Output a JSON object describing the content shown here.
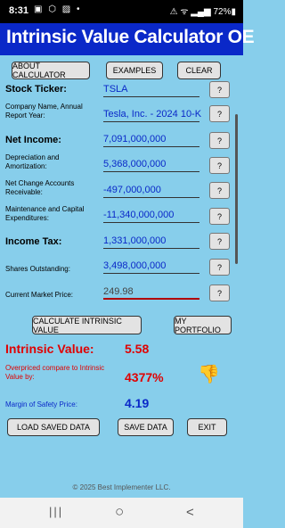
{
  "status": {
    "time": "8:31",
    "left_icons": "▣ ⬡ ▨ •",
    "right_icons": "⚠ ᯤ ▂▄▆ 72%▮"
  },
  "app": {
    "title": "Intrinsic Value Calculator OE"
  },
  "toolbar": {
    "about": "ABOUT CALCULATOR",
    "examples": "EXAMPLES",
    "clear": "CLEAR"
  },
  "fields": {
    "stock_ticker": {
      "label": "Stock Ticker:",
      "value": "TSLA"
    },
    "company_name": {
      "label": "Company Name,  Annual Report Year:",
      "value": "Tesla, Inc. - 2024 10-K"
    },
    "net_income": {
      "label": "Net Income:",
      "value": "7,091,000,000"
    },
    "depreciation": {
      "label": "Depreciation and Amortization:",
      "value": "5,368,000,000"
    },
    "net_change_ar": {
      "label": "Net Change Accounts Receivable:",
      "value": "-497,000,000"
    },
    "maintenance_capex": {
      "label": "Maintenance and Capital Expenditures:",
      "value": "-11,340,000,000"
    },
    "income_tax": {
      "label": "Income Tax:",
      "value": "1,331,000,000"
    },
    "shares_outstanding": {
      "label": "Shares Outstanding:",
      "value": "3,498,000,000"
    },
    "market_price": {
      "label": "Current Market Price:",
      "value": "249.98"
    }
  },
  "help_label": "?",
  "actions": {
    "calculate": "CALCULATE INTRINSIC  VALUE",
    "portfolio": "MY PORTFOLIO"
  },
  "results": {
    "intrinsic_label": "Intrinsic Value:",
    "intrinsic_value": "5.58",
    "overpriced_label": "Overpriced compare to Intrinsic Value by:",
    "overpriced_value": "4377%",
    "margin_label": "Margin of Safety Price:",
    "margin_value": "4.19"
  },
  "bottom_buttons": {
    "load": "LOAD  SAVED DATA",
    "save": "SAVE DATA",
    "exit": "EXIT"
  },
  "footer": "© 2025 Best Implementer LLC.",
  "nav": {
    "recents": "|||",
    "home": "○",
    "back": "<"
  },
  "icons": {
    "thumbs_down": "👎"
  },
  "colors": {
    "header": "#0a28c8",
    "background": "#87ceeb",
    "value_text": "#0a28c8",
    "alert": "#e00000",
    "thumb": "#f0b000"
  }
}
